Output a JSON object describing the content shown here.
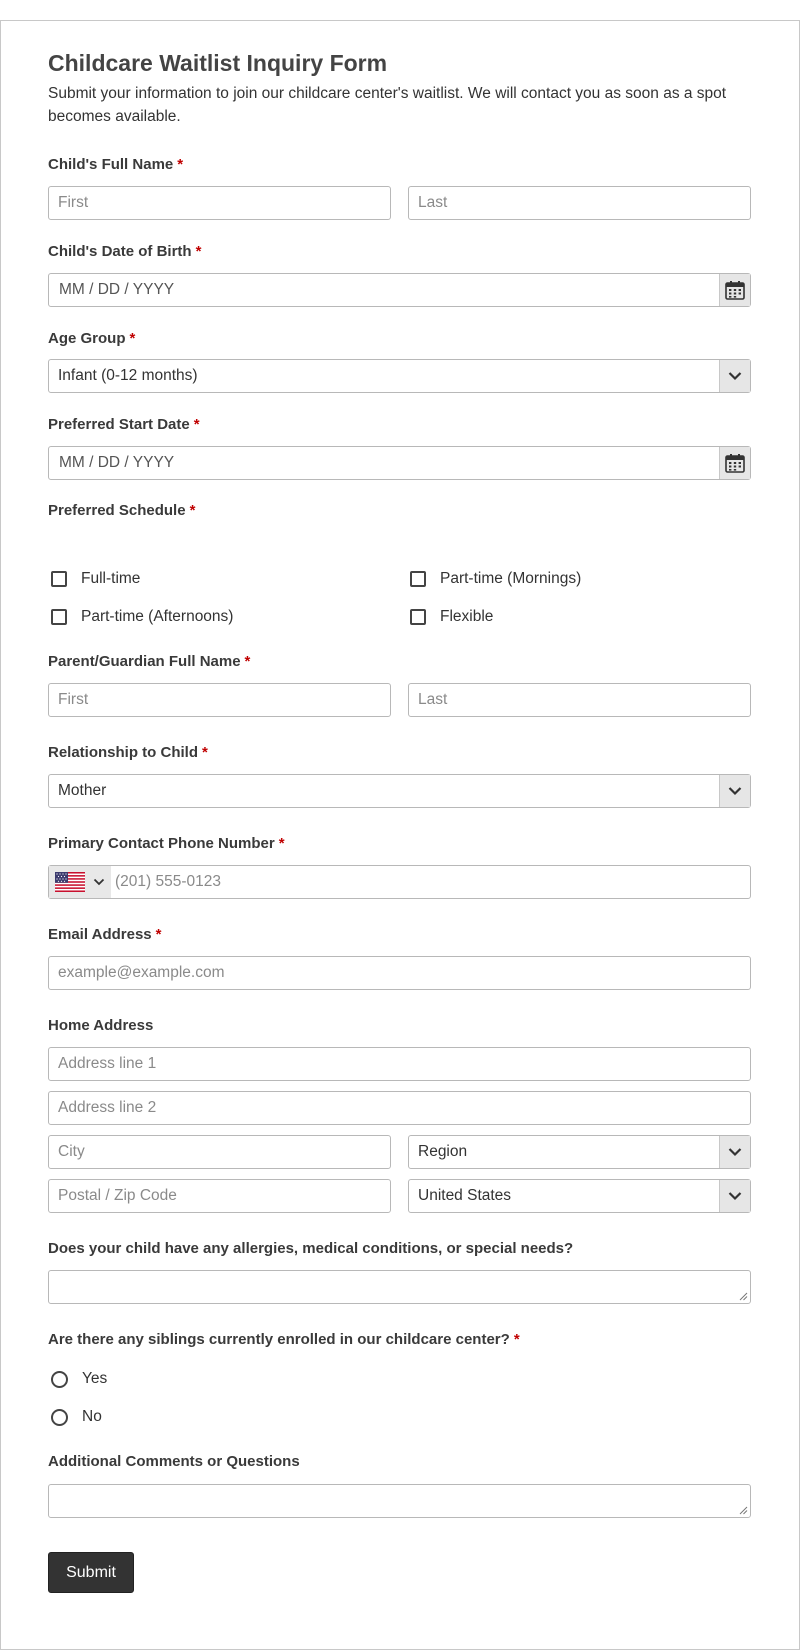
{
  "form": {
    "title": "Childcare Waitlist Inquiry Form",
    "description": "Submit your information to join our childcare center's waitlist. We will contact you as soon as a spot becomes available."
  },
  "required_mark": "*",
  "child_name": {
    "label": "Child's Full Name",
    "first_placeholder": "First",
    "last_placeholder": "Last"
  },
  "child_dob": {
    "label": "Child's Date of Birth",
    "placeholder": "MM / DD / YYYY"
  },
  "age_group": {
    "label": "Age Group",
    "selected": "Infant (0-12 months)"
  },
  "start_date": {
    "label": "Preferred Start Date",
    "placeholder": "MM / DD / YYYY"
  },
  "schedule": {
    "label": "Preferred Schedule",
    "options": [
      "Full-time",
      "Part-time (Mornings)",
      "Part-time (Afternoons)",
      "Flexible"
    ]
  },
  "guardian_name": {
    "label": "Parent/Guardian Full Name",
    "first_placeholder": "First",
    "last_placeholder": "Last"
  },
  "relationship": {
    "label": "Relationship to Child",
    "selected": "Mother"
  },
  "phone": {
    "label": "Primary Contact Phone Number",
    "country_icon": "us-flag-icon",
    "placeholder": "(201) 555-0123"
  },
  "email": {
    "label": "Email Address",
    "placeholder": "example@example.com"
  },
  "address": {
    "label": "Home Address",
    "line1_placeholder": "Address line 1",
    "line2_placeholder": "Address line 2",
    "city_placeholder": "City",
    "region_selected": "Region",
    "postal_placeholder": "Postal / Zip Code",
    "country_selected": "United States"
  },
  "medical": {
    "label": "Does your child have any allergies, medical conditions, or special needs?"
  },
  "siblings": {
    "label": "Are there any siblings currently enrolled in our childcare center?",
    "options": [
      "Yes",
      "No"
    ]
  },
  "comments": {
    "label": "Additional Comments or Questions"
  },
  "submit": {
    "label": "Submit"
  },
  "colors": {
    "required": "#c00000",
    "button_bg": "#333333",
    "border": "#b8b8b8"
  }
}
